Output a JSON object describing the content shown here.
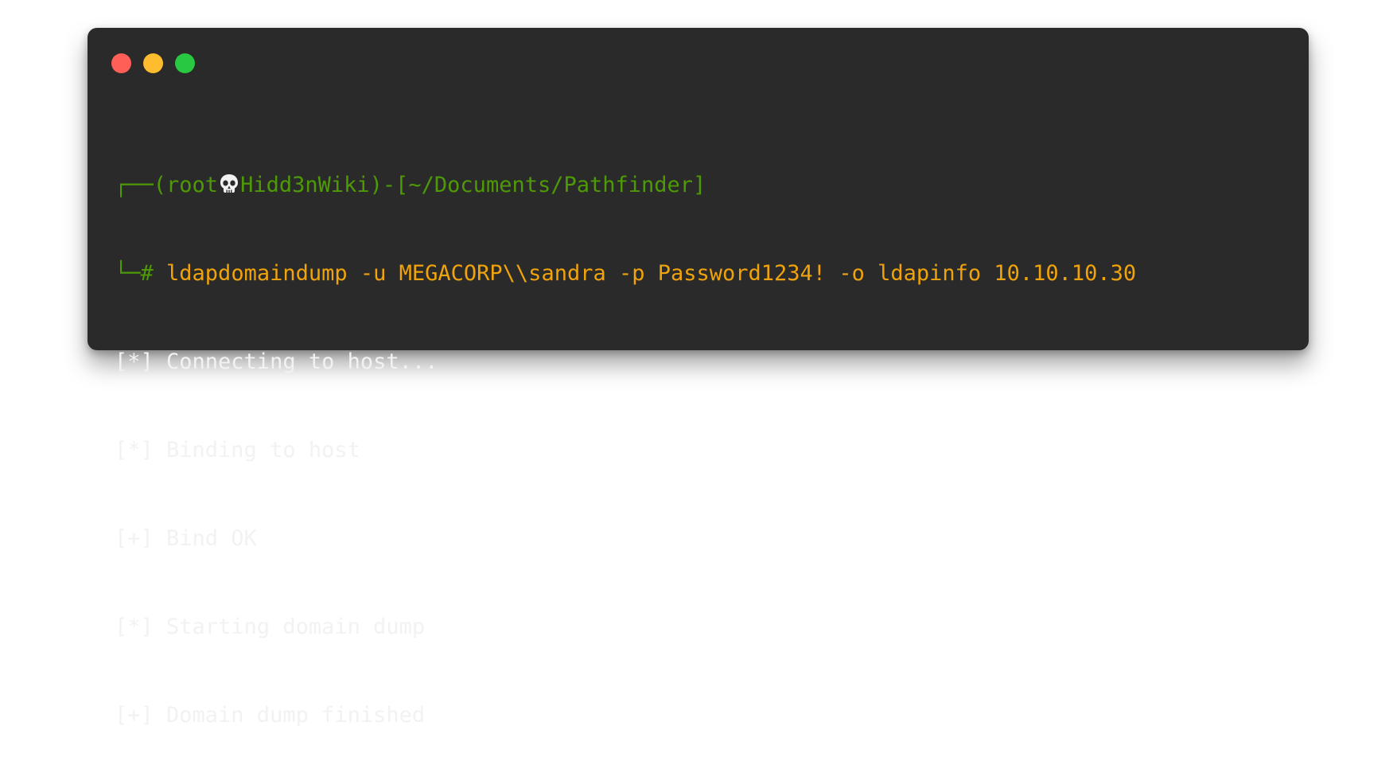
{
  "window": {
    "lights": [
      {
        "name": "close",
        "color": "#ff5f57"
      },
      {
        "name": "minimize",
        "color": "#febc2e"
      },
      {
        "name": "zoom",
        "color": "#28c840"
      }
    ]
  },
  "terminal": {
    "prompt": {
      "line1_prefix": "┌──(",
      "user": "root",
      "skull_icon": "skull-icon",
      "host": "Hidd3nWiki",
      "dir_open": ")-[",
      "cwd": "~/Documents/Pathfinder",
      "dir_close": "]",
      "line2_prefix": "└─",
      "symbol": "#"
    },
    "command": " ldapdomaindump -u MEGACORP\\\\sandra -p Password1234! -o ldapinfo 10.10.10.30",
    "output": [
      "[*] Connecting to host...",
      "[*] Binding to host",
      "[+] Bind OK",
      "[*] Starting domain dump",
      "[+] Domain dump finished"
    ],
    "colors": {
      "prompt": "#4e9a06",
      "command": "#f0a30a",
      "output": "#f2f2f2",
      "background": "#2a2a2a"
    }
  }
}
